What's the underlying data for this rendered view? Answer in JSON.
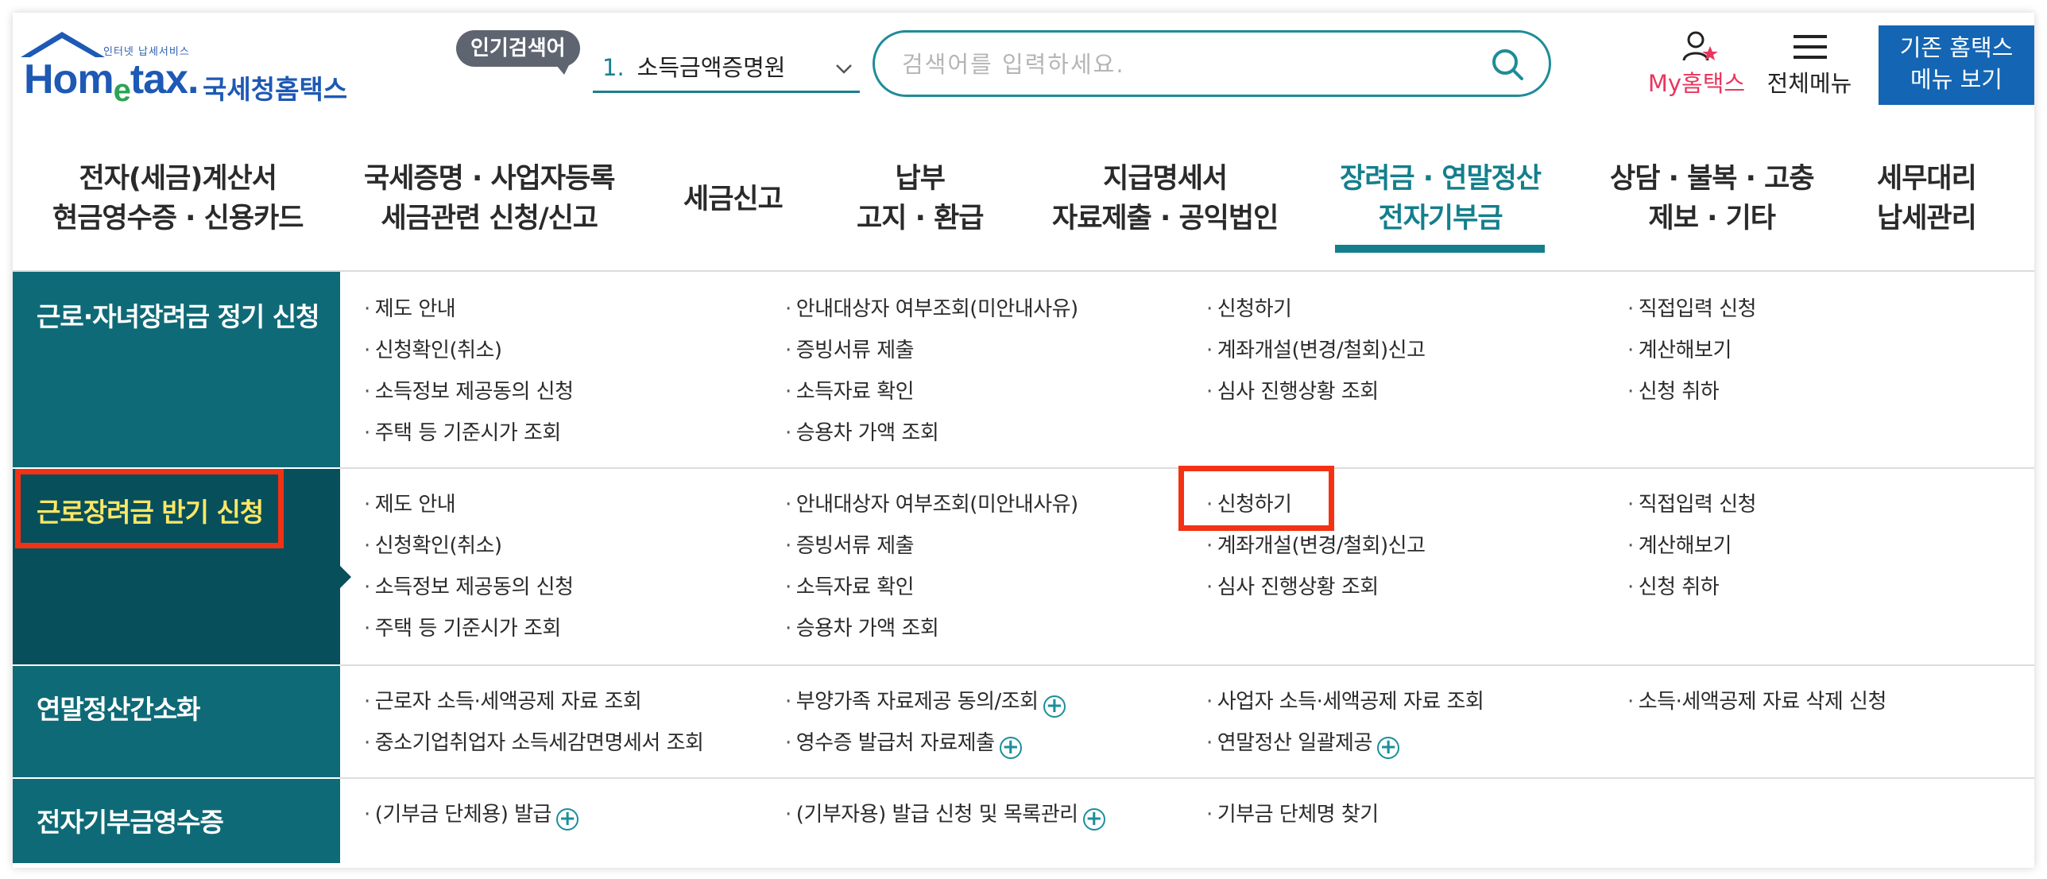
{
  "logo": {
    "tagline": "인터넷 납세서비스",
    "brand_prefix": "Hom",
    "brand_e": "e",
    "brand_suffix": "tax.",
    "brand_kr": "국세청홈택스"
  },
  "header": {
    "popular_label": "인기검색어",
    "popular_rank": "1.",
    "popular_term": "소득금액증명원",
    "search_placeholder": "검색어를 입력하세요.",
    "my_hometax": "My홈택스",
    "all_menu": "전체메뉴",
    "old_menu_line1": "기존 홈택스",
    "old_menu_line2": "메뉴 보기"
  },
  "gnb": [
    {
      "line1": "전자(세금)계산서",
      "line2": "현금영수증 · 신용카드"
    },
    {
      "line1": "국세증명 · 사업자등록",
      "line2": "세금관련 신청/신고"
    },
    {
      "line1": "세금신고",
      "line2": ""
    },
    {
      "line1": "납부",
      "line2": "고지 · 환급"
    },
    {
      "line1": "지급명세서",
      "line2": "자료제출 · 공익법인"
    },
    {
      "line1": "장려금 · 연말정산",
      "line2": "전자기부금"
    },
    {
      "line1": "상담 · 불복 · 고충",
      "line2": "제보 · 기타"
    },
    {
      "line1": "세무대리",
      "line2": "납세관리"
    }
  ],
  "categories": [
    {
      "label": "근로·자녀장려금 정기 신청",
      "links": [
        [
          "제도 안내",
          "안내대상자 여부조회(미안내사유)",
          "신청하기",
          "직접입력 신청"
        ],
        [
          "신청확인(취소)",
          "증빙서류 제출",
          "계좌개설(변경/철회)신고",
          "계산해보기"
        ],
        [
          "소득정보 제공동의 신청",
          "소득자료 확인",
          "심사 진행상황 조회",
          "신청 취하"
        ],
        [
          "주택 등 기준시가 조회",
          "승용차 가액 조회"
        ]
      ]
    },
    {
      "label": "근로장려금 반기 신청",
      "links": [
        [
          "제도 안내",
          "안내대상자 여부조회(미안내사유)",
          "신청하기",
          "직접입력 신청"
        ],
        [
          "신청확인(취소)",
          "증빙서류 제출",
          "계좌개설(변경/철회)신고",
          "계산해보기"
        ],
        [
          "소득정보 제공동의 신청",
          "소득자료 확인",
          "심사 진행상황 조회",
          "신청 취하"
        ],
        [
          "주택 등 기준시가 조회",
          "승용차 가액 조회"
        ]
      ]
    },
    {
      "label": "연말정산간소화",
      "links": [
        [
          "근로자 소득·세액공제 자료 조회",
          "부양가족 자료제공 동의/조회",
          "사업자 소득·세액공제 자료 조회",
          "소득·세액공제 자료 삭제 신청"
        ],
        [
          "중소기업취업자 소득세감면명세서 조회",
          "영수증 발급처 자료제출",
          "연말정산 일괄제공"
        ]
      ]
    },
    {
      "label": "전자기부금영수증",
      "links": [
        [
          "(기부금 단체용) 발급",
          "(기부자용) 발급 신청 및 목록관리",
          "기부금 단체명 찾기"
        ]
      ]
    }
  ],
  "plus_symbol": "+",
  "colors": {
    "brand_blue": "#1d59b5",
    "teal": "#137f8c",
    "category_bg": "#0f6a77",
    "category_active_bg": "#074f5b",
    "category_active_text": "#fde765",
    "highlight_red": "#f23214",
    "my_hometax_pink": "#e8375f",
    "old_menu_button": "#1465b3"
  },
  "icons": [
    "house-roof-icon",
    "chevron-down-icon",
    "search-icon",
    "user-star-icon",
    "hamburger-icon",
    "plus-circle-icon"
  ]
}
